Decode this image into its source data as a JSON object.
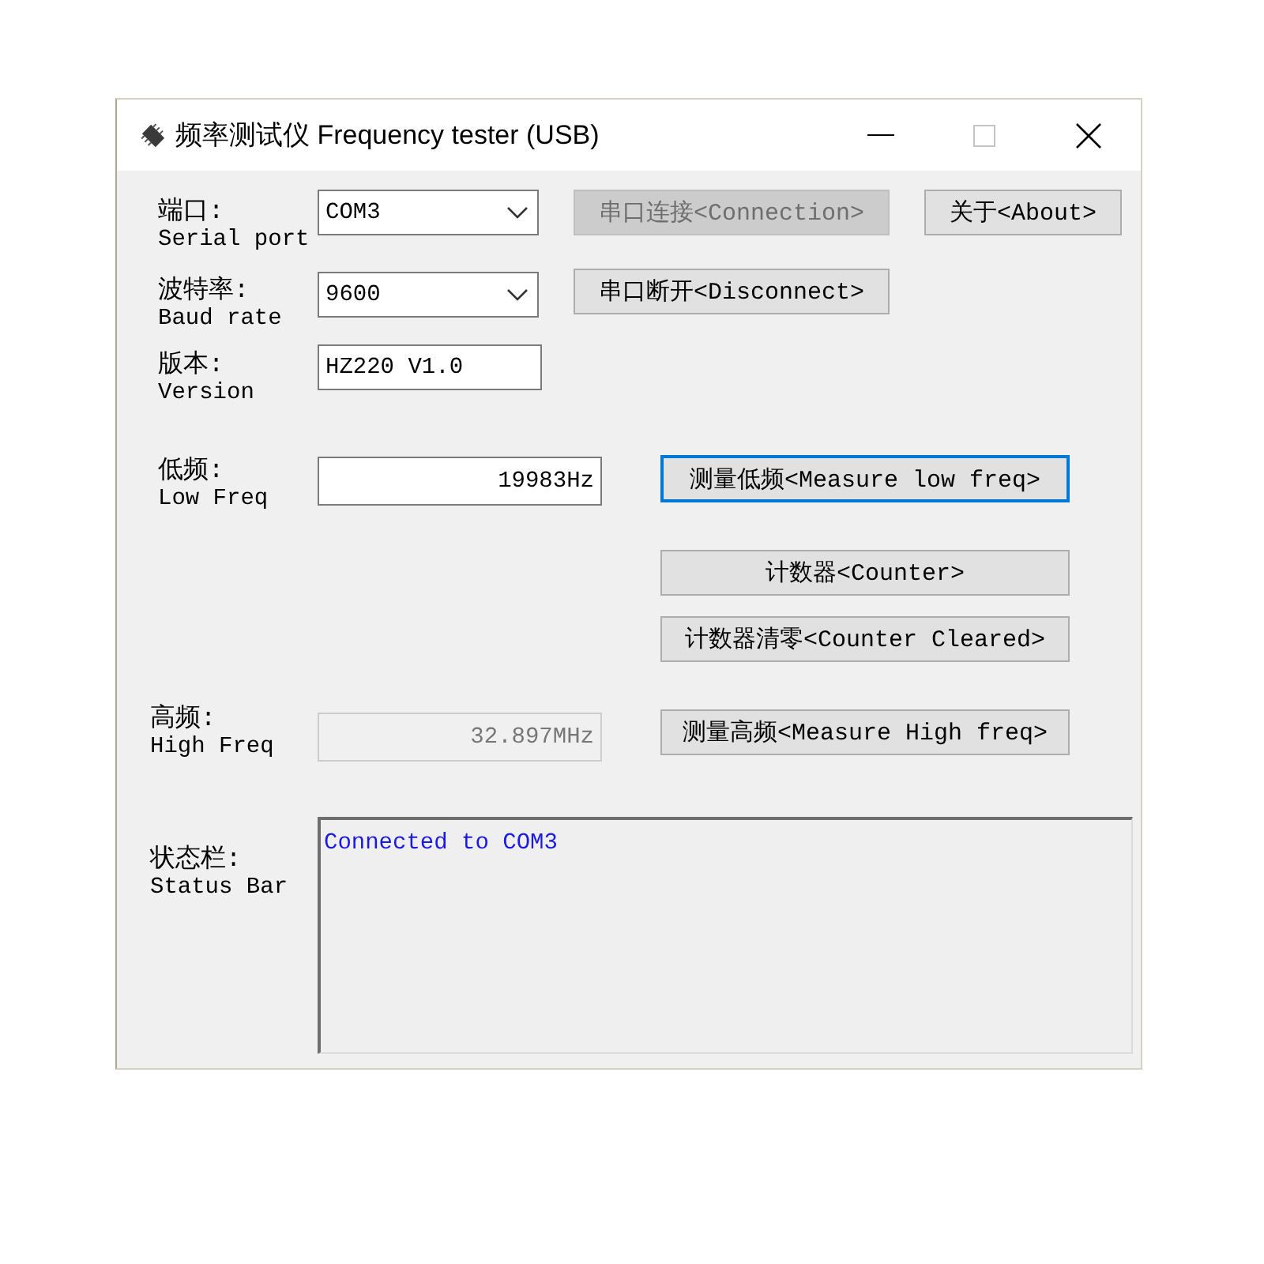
{
  "window": {
    "title": "频率测试仪 Frequency tester (USB)",
    "maximize_disabled": true
  },
  "rows": [
    {
      "kind": "setting",
      "label": "端口:",
      "sublabel": "Serial port",
      "field": {
        "kind": "combo",
        "value": "COM3",
        "disabled": false
      },
      "buttons": [
        {
          "label": "串口连接<Connection>",
          "disabled": true,
          "focused": false
        },
        {
          "label": "关于<About>",
          "disabled": false,
          "focused": false
        }
      ]
    },
    {
      "kind": "setting",
      "label": "波特率:",
      "sublabel": "Baud rate",
      "field": {
        "kind": "combo",
        "value": "9600",
        "disabled": false
      },
      "buttons": [
        {
          "label": "串口断开<Disconnect>",
          "disabled": false,
          "focused": false
        }
      ]
    },
    {
      "kind": "setting",
      "label": "版本:",
      "sublabel": "Version",
      "field": {
        "kind": "text",
        "value": "HZ220 V1.0",
        "disabled": false
      }
    },
    {
      "kind": "measure",
      "label": "低频:",
      "sublabel": "Low Freq",
      "field": {
        "kind": "number",
        "value": "19983Hz",
        "disabled": false
      },
      "buttons": [
        {
          "label": "测量低频<Measure low freq>",
          "disabled": false,
          "focused": true
        }
      ]
    },
    {
      "kind": "measure",
      "buttons": [
        {
          "label": "计数器<Counter>",
          "disabled": false,
          "focused": false
        }
      ]
    },
    {
      "kind": "measure",
      "buttons": [
        {
          "label": "计数器清零<Counter Cleared>",
          "disabled": false,
          "focused": false
        }
      ]
    },
    {
      "kind": "measure",
      "label": "高频:",
      "sublabel": "High Freq",
      "field": {
        "kind": "number",
        "value": "32.897MHz",
        "disabled": true
      },
      "buttons": [
        {
          "label": "测量高频<Measure High freq>",
          "disabled": false,
          "focused": false
        }
      ]
    }
  ],
  "status_bar": {
    "label": "状态栏:",
    "sublabel": "Status Bar",
    "message": "Connected to COM3"
  }
}
